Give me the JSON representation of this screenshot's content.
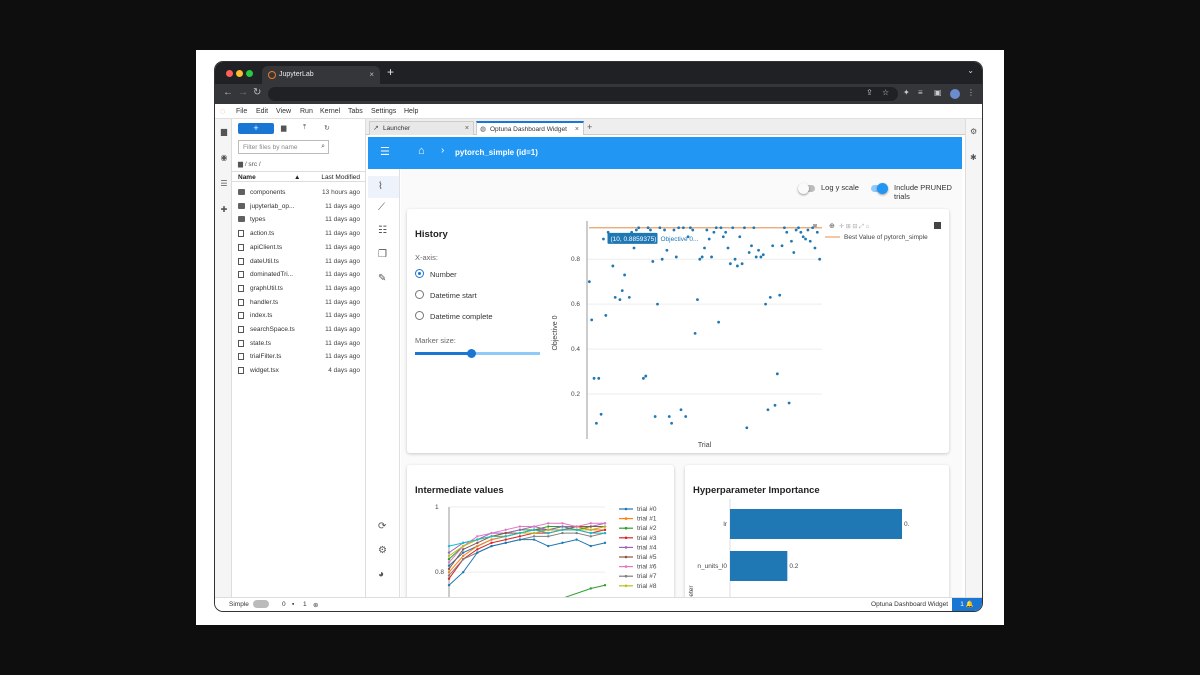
{
  "browser": {
    "tab_title": "JupyterLab",
    "tab_close": "×",
    "new_tab": "+",
    "expand": "⌄",
    "back": "←",
    "forward": "→",
    "reload": "↻"
  },
  "jupyter": {
    "menu": [
      "File",
      "Edit",
      "View",
      "Run",
      "Kernel",
      "Tabs",
      "Settings",
      "Help"
    ],
    "filebrowser": {
      "new_label": "+",
      "filter_placeholder": "Filter files by name",
      "path": "/ src /",
      "col_name": "Name",
      "col_modified": "Last Modified",
      "sort_arrow": "▲",
      "items": [
        {
          "name": "components",
          "modified": "13 hours ago",
          "type": "folder"
        },
        {
          "name": "jupyterlab_op...",
          "modified": "11 days ago",
          "type": "folder"
        },
        {
          "name": "types",
          "modified": "11 days ago",
          "type": "folder"
        },
        {
          "name": "action.ts",
          "modified": "11 days ago",
          "type": "ts"
        },
        {
          "name": "apiClient.ts",
          "modified": "11 days ago",
          "type": "ts"
        },
        {
          "name": "dateUtil.ts",
          "modified": "11 days ago",
          "type": "ts"
        },
        {
          "name": "dominatedTri...",
          "modified": "11 days ago",
          "type": "ts"
        },
        {
          "name": "graphUtil.ts",
          "modified": "11 days ago",
          "type": "ts"
        },
        {
          "name": "handler.ts",
          "modified": "11 days ago",
          "type": "ts"
        },
        {
          "name": "index.ts",
          "modified": "11 days ago",
          "type": "ts"
        },
        {
          "name": "searchSpace.ts",
          "modified": "11 days ago",
          "type": "ts"
        },
        {
          "name": "state.ts",
          "modified": "11 days ago",
          "type": "ts"
        },
        {
          "name": "trialFilter.ts",
          "modified": "11 days ago",
          "type": "ts"
        },
        {
          "name": "widget.tsx",
          "modified": "4 days ago",
          "type": "tsx"
        }
      ]
    },
    "tabs": [
      {
        "label": "Launcher",
        "active": false
      },
      {
        "label": "Optuna Dashboard Widget",
        "active": true
      }
    ],
    "tab_add": "+",
    "status": {
      "mode": "Simple",
      "kernels": "0",
      "terminals": "1",
      "widget": "Optuna Dashboard Widget",
      "notifications": "1"
    }
  },
  "dashboard": {
    "breadcrumb_sep": "›",
    "study_title": "pytorch_simple (id=1)",
    "log_y_label": "Log y scale",
    "log_y": false,
    "pruned_label": "Include PRUNED trials",
    "pruned": true,
    "history": {
      "title": "History",
      "xaxis_label": "X-axis:",
      "options": [
        "Number",
        "Datetime start",
        "Datetime complete"
      ],
      "selected": "Number",
      "marker_label": "Marker size:",
      "marker_fraction": 0.45
    },
    "intermediate_title": "Intermediate values",
    "importance_title": "Hyperparameter Importance"
  },
  "colors": {
    "accent": "#2196f3",
    "point": "#1f77b4",
    "best": "#e9a06a"
  },
  "chart_data": [
    {
      "type": "scatter",
      "title": "",
      "xlabel": "Trial",
      "ylabel": "Objective 0",
      "ylim": [
        0.0,
        0.97
      ],
      "xlim": [
        0,
        100
      ],
      "yticks": [
        "0.2",
        "0.4",
        "0.6",
        "0.8"
      ],
      "tooltip": "(10, 0.8859375)",
      "tooltip_series": "Objective 0...",
      "legend": [
        "Best Value of pytorch_simple"
      ],
      "best_value": 0.94,
      "points": [
        [
          1,
          0.7
        ],
        [
          2,
          0.53
        ],
        [
          3,
          0.27
        ],
        [
          4,
          0.07
        ],
        [
          5,
          0.27
        ],
        [
          6,
          0.11
        ],
        [
          7,
          0.89
        ],
        [
          8,
          0.55
        ],
        [
          9,
          0.92
        ],
        [
          10,
          0.89
        ],
        [
          11,
          0.77
        ],
        [
          12,
          0.63
        ],
        [
          13,
          0.89
        ],
        [
          14,
          0.62
        ],
        [
          15,
          0.66
        ],
        [
          16,
          0.73
        ],
        [
          17,
          0.89
        ],
        [
          18,
          0.63
        ],
        [
          19,
          0.92
        ],
        [
          20,
          0.85
        ],
        [
          21,
          0.93
        ],
        [
          22,
          0.94
        ],
        [
          23,
          0.88
        ],
        [
          24,
          0.27
        ],
        [
          25,
          0.28
        ],
        [
          26,
          0.94
        ],
        [
          27,
          0.93
        ],
        [
          28,
          0.79
        ],
        [
          29,
          0.1
        ],
        [
          30,
          0.6
        ],
        [
          31,
          0.94
        ],
        [
          32,
          0.8
        ],
        [
          33,
          0.93
        ],
        [
          34,
          0.84
        ],
        [
          35,
          0.1
        ],
        [
          36,
          0.07
        ],
        [
          37,
          0.93
        ],
        [
          38,
          0.81
        ],
        [
          39,
          0.94
        ],
        [
          40,
          0.13
        ],
        [
          41,
          0.94
        ],
        [
          42,
          0.1
        ],
        [
          43,
          0.9
        ],
        [
          44,
          0.94
        ],
        [
          45,
          0.93
        ],
        [
          46,
          0.47
        ],
        [
          47,
          0.62
        ],
        [
          48,
          0.8
        ],
        [
          49,
          0.81
        ],
        [
          50,
          0.85
        ],
        [
          51,
          0.93
        ],
        [
          52,
          0.89
        ],
        [
          53,
          0.81
        ],
        [
          54,
          0.92
        ],
        [
          55,
          0.94
        ],
        [
          56,
          0.52
        ],
        [
          57,
          0.94
        ],
        [
          58,
          0.9
        ],
        [
          59,
          0.92
        ],
        [
          60,
          0.85
        ],
        [
          61,
          0.78
        ],
        [
          62,
          0.94
        ],
        [
          63,
          0.8
        ],
        [
          64,
          0.77
        ],
        [
          65,
          0.9
        ],
        [
          66,
          0.78
        ],
        [
          67,
          0.94
        ],
        [
          68,
          0.05
        ],
        [
          69,
          0.83
        ],
        [
          70,
          0.86
        ],
        [
          71,
          0.94
        ],
        [
          72,
          0.81
        ],
        [
          73,
          0.84
        ],
        [
          74,
          0.81
        ],
        [
          75,
          0.82
        ],
        [
          76,
          0.6
        ],
        [
          77,
          0.13
        ],
        [
          78,
          0.63
        ],
        [
          79,
          0.86
        ],
        [
          80,
          0.15
        ],
        [
          81,
          0.29
        ],
        [
          82,
          0.64
        ],
        [
          83,
          0.86
        ],
        [
          84,
          0.94
        ],
        [
          85,
          0.92
        ],
        [
          86,
          0.16
        ],
        [
          87,
          0.88
        ],
        [
          88,
          0.83
        ],
        [
          89,
          0.93
        ],
        [
          90,
          0.94
        ],
        [
          91,
          0.92
        ],
        [
          92,
          0.9
        ],
        [
          93,
          0.89
        ],
        [
          94,
          0.93
        ],
        [
          95,
          0.88
        ],
        [
          96,
          0.94
        ],
        [
          97,
          0.85
        ],
        [
          98,
          0.92
        ],
        [
          99,
          0.8
        ]
      ]
    },
    {
      "type": "line",
      "title": "Intermediate values",
      "yticks": [
        "1",
        "0.8"
      ],
      "ylim": [
        0.73,
        1.0
      ],
      "legend": [
        "trial #0",
        "trial #1",
        "trial #2",
        "trial #3",
        "trial #4",
        "trial #5",
        "trial #6",
        "trial #7",
        "trial #8"
      ],
      "series_colors": [
        "#1f77b4",
        "#ff7f0e",
        "#2ca02c",
        "#d62728",
        "#9467bd",
        "#8c564b",
        "#e377c2",
        "#7f7f7f",
        "#bcbd22",
        "#17becf"
      ],
      "series": [
        {
          "name": "trial #0",
          "values": [
            0.82,
            0.86,
            0.88,
            0.9,
            0.91,
            0.92,
            0.93,
            0.93,
            0.94,
            0.94,
            0.93,
            0.94
          ]
        },
        {
          "name": "trial #1",
          "values": [
            0.8,
            0.85,
            0.88,
            0.9,
            0.91,
            0.92,
            0.93,
            0.92,
            0.93,
            0.94,
            0.93,
            0.93
          ]
        },
        {
          "name": "trial #2",
          "values": [
            0.84,
            0.88,
            0.9,
            0.91,
            0.92,
            0.93,
            0.93,
            0.94,
            0.94,
            0.93,
            0.94,
            0.94
          ]
        },
        {
          "name": "trial #3",
          "values": [
            0.78,
            0.84,
            0.87,
            0.89,
            0.9,
            0.91,
            0.92,
            0.92,
            0.93,
            0.93,
            0.92,
            0.93
          ]
        },
        {
          "name": "trial #4",
          "values": [
            0.86,
            0.89,
            0.9,
            0.92,
            0.92,
            0.93,
            0.94,
            0.93,
            0.94,
            0.94,
            0.94,
            0.95
          ]
        },
        {
          "name": "trial #5",
          "values": [
            0.81,
            0.87,
            0.89,
            0.91,
            0.92,
            0.92,
            0.93,
            0.93,
            0.93,
            0.94,
            0.94,
            0.94
          ]
        },
        {
          "name": "trial #6",
          "values": [
            0.83,
            0.88,
            0.91,
            0.92,
            0.93,
            0.94,
            0.94,
            0.95,
            0.95,
            0.94,
            0.95,
            0.95
          ]
        },
        {
          "name": "trial #7",
          "values": [
            0.79,
            0.84,
            0.86,
            0.88,
            0.89,
            0.9,
            0.91,
            0.91,
            0.92,
            0.92,
            0.91,
            0.92
          ]
        },
        {
          "name": "trial #8",
          "values": [
            0.85,
            0.88,
            0.9,
            0.91,
            0.91,
            0.92,
            0.92,
            0.93,
            0.93,
            0.93,
            0.93,
            0.94
          ]
        },
        {
          "name": "",
          "values": [
            0.88,
            0.89,
            0.9,
            0.91,
            0.91,
            0.92,
            0.93,
            0.92,
            0.93,
            0.93,
            0.92,
            0.92
          ]
        },
        {
          "name": "",
          "values": [
            0.76,
            0.8,
            0.86,
            0.88,
            0.89,
            0.9,
            0.9,
            0.88,
            0.89,
            0.9,
            0.88,
            0.89
          ]
        }
      ]
    },
    {
      "type": "bar",
      "title": "Hyperparameter Importance",
      "categories": [
        "lr",
        "n_units_l0"
      ],
      "values": [
        0.6,
        0.2
      ],
      "value_labels": [
        "0.",
        "0.2"
      ],
      "ylabel": "eter"
    }
  ]
}
